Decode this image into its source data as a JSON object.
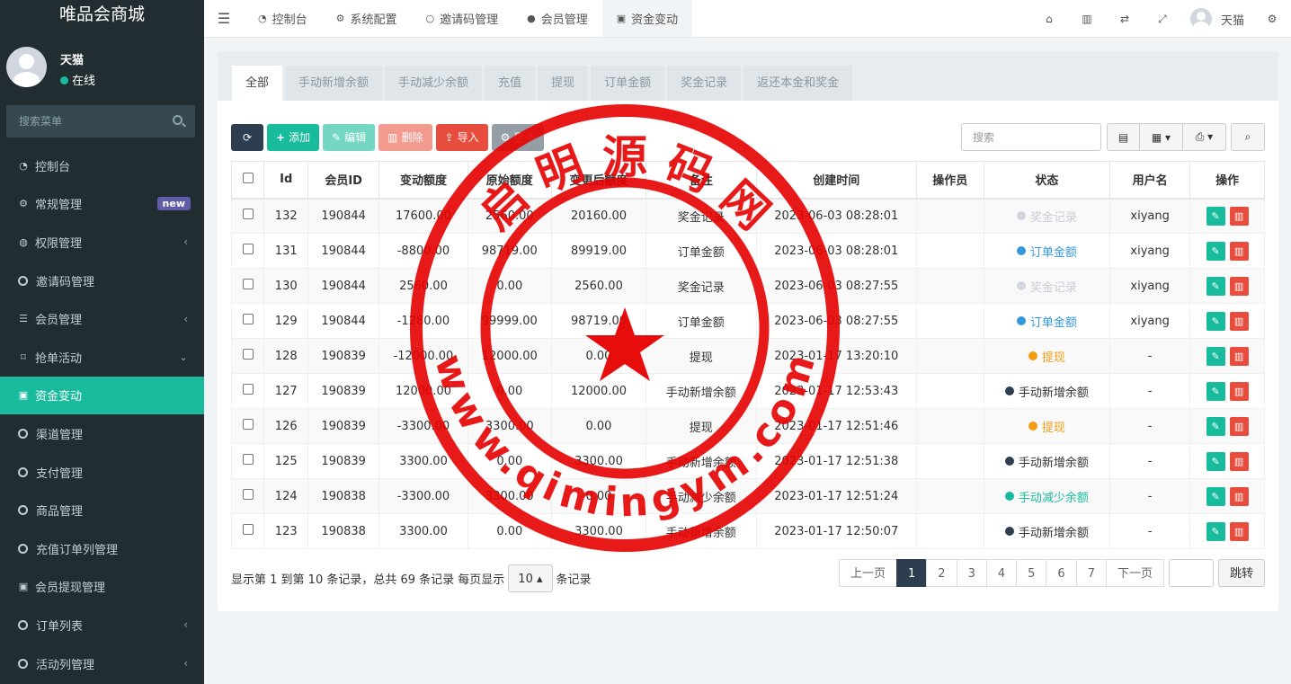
{
  "app": {
    "title": "唯品会商城"
  },
  "user": {
    "name": "天猫",
    "status": "在线"
  },
  "sidebar": {
    "search_placeholder": "搜索菜单",
    "items": [
      {
        "label": "控制台",
        "icon": "dashboard-icon",
        "glyph": "◔"
      },
      {
        "label": "常规管理",
        "icon": "gears-icon",
        "glyph": "⚙",
        "badge": "new"
      },
      {
        "label": "权限管理",
        "icon": "group-icon",
        "glyph": "◍",
        "caret": "‹"
      },
      {
        "label": "邀请码管理",
        "icon": "circle-icon",
        "glyph": ""
      },
      {
        "label": "会员管理",
        "icon": "list-icon",
        "glyph": "☰",
        "caret": "‹"
      },
      {
        "label": "抢单活动",
        "icon": "bookmark-icon",
        "glyph": "⌑",
        "caret": "⌄"
      },
      {
        "label": "资金变动",
        "icon": "money-icon",
        "glyph": "▣",
        "active": true
      },
      {
        "label": "渠道管理",
        "icon": "circle-icon",
        "glyph": ""
      },
      {
        "label": "支付管理",
        "icon": "circle-icon",
        "glyph": ""
      },
      {
        "label": "商品管理",
        "icon": "circle-icon",
        "glyph": ""
      },
      {
        "label": "充值订单列管理",
        "icon": "circle-icon",
        "glyph": ""
      },
      {
        "label": "会员提现管理",
        "icon": "money-icon",
        "glyph": "▣"
      },
      {
        "label": "订单列表",
        "icon": "circle-icon",
        "glyph": "",
        "caret": "‹"
      },
      {
        "label": "活动列管理",
        "icon": "circle-icon",
        "glyph": "",
        "caret": "‹"
      }
    ]
  },
  "topnav": {
    "tabs": [
      {
        "label": "控制台",
        "icon": "dashboard-icon",
        "glyph": "◔"
      },
      {
        "label": "系统配置",
        "icon": "gear-icon",
        "glyph": "⚙"
      },
      {
        "label": "邀请码管理",
        "icon": "circle-icon",
        "glyph": "○"
      },
      {
        "label": "会员管理",
        "icon": "user-icon",
        "glyph": "●"
      },
      {
        "label": "资金变动",
        "icon": "money-icon",
        "glyph": "▣",
        "active": true
      }
    ],
    "right_icons": [
      {
        "name": "home-icon",
        "glyph": "⌂"
      },
      {
        "name": "trash-icon",
        "glyph": "▥"
      },
      {
        "name": "translate-icon",
        "glyph": "⇄"
      },
      {
        "name": "fullscreen-icon",
        "glyph": "⤢"
      }
    ],
    "username": "天猫",
    "settings_glyph": "⚙"
  },
  "content": {
    "filter_tabs": [
      "全部",
      "手动新增余额",
      "手动减少余额",
      "充值",
      "提现",
      "订单金额",
      "奖金记录",
      "返还本金和奖金"
    ],
    "active_filter": 0,
    "toolbar": {
      "refresh": "⟳",
      "add": "添加",
      "edit": "编辑",
      "delete": "删除",
      "import": "导入",
      "more": "更多"
    },
    "search_placeholder": "搜索",
    "columns": [
      "",
      "Id",
      "会员ID",
      "变动额度",
      "原始额度",
      "变更后额度",
      "备注",
      "创建时间",
      "操作员",
      "状态",
      "用户名",
      "操作"
    ],
    "rows": [
      {
        "id": "132",
        "member": "190844",
        "change": "17600.00",
        "orig": "2560.00",
        "after": "20160.00",
        "note": "奖金记录",
        "time": "2023-06-03 08:28:01",
        "op": "",
        "status": "奖金记录",
        "scolor": "#d2d6de",
        "tcolor": "#c8cdd2",
        "user": "xiyang"
      },
      {
        "id": "131",
        "member": "190844",
        "change": "-8800.00",
        "orig": "98719.00",
        "after": "89919.00",
        "note": "订单金额",
        "time": "2023-06-03 08:28:01",
        "op": "",
        "status": "订单金额",
        "scolor": "#3498db",
        "tcolor": "#3498db",
        "user": "xiyang"
      },
      {
        "id": "130",
        "member": "190844",
        "change": "2560.00",
        "orig": "0.00",
        "after": "2560.00",
        "note": "奖金记录",
        "time": "2023-06-03 08:27:55",
        "op": "",
        "status": "奖金记录",
        "scolor": "#d2d6de",
        "tcolor": "#c8cdd2",
        "user": "xiyang"
      },
      {
        "id": "129",
        "member": "190844",
        "change": "-1280.00",
        "orig": "99999.00",
        "after": "98719.00",
        "note": "订单金额",
        "time": "2023-06-03 08:27:55",
        "op": "",
        "status": "订单金额",
        "scolor": "#3498db",
        "tcolor": "#3498db",
        "user": "xiyang"
      },
      {
        "id": "128",
        "member": "190839",
        "change": "-12000.00",
        "orig": "12000.00",
        "after": "0.00",
        "note": "提现",
        "time": "2023-01-17 13:20:10",
        "op": "",
        "status": "提现",
        "scolor": "#f39c12",
        "tcolor": "#f39c12",
        "user": "-"
      },
      {
        "id": "127",
        "member": "190839",
        "change": "12000.00",
        "orig": "0.00",
        "after": "12000.00",
        "note": "手动新增余额",
        "time": "2023-01-17 12:53:43",
        "op": "",
        "status": "手动新增余额",
        "scolor": "#2c3e50",
        "tcolor": "#333333",
        "user": "-"
      },
      {
        "id": "126",
        "member": "190839",
        "change": "-3300.00",
        "orig": "3300.00",
        "after": "0.00",
        "note": "提现",
        "time": "2023-01-17 12:51:46",
        "op": "",
        "status": "提现",
        "scolor": "#f39c12",
        "tcolor": "#f39c12",
        "user": "-"
      },
      {
        "id": "125",
        "member": "190839",
        "change": "3300.00",
        "orig": "0.00",
        "after": "3300.00",
        "note": "手动新增余额",
        "time": "2023-01-17 12:51:38",
        "op": "",
        "status": "手动新增余额",
        "scolor": "#2c3e50",
        "tcolor": "#333333",
        "user": "-"
      },
      {
        "id": "124",
        "member": "190838",
        "change": "-3300.00",
        "orig": "3300.00",
        "after": "0.00",
        "note": "手动减少余额",
        "time": "2023-01-17 12:51:24",
        "op": "",
        "status": "手动减少余额",
        "scolor": "#18bc9c",
        "tcolor": "#18bc9c",
        "user": "-"
      },
      {
        "id": "123",
        "member": "190838",
        "change": "3300.00",
        "orig": "0.00",
        "after": "3300.00",
        "note": "手动新增余额",
        "time": "2023-01-17 12:50:07",
        "op": "",
        "status": "手动新增余额",
        "scolor": "#2c3e50",
        "tcolor": "#333333",
        "user": "-"
      }
    ],
    "pagination": {
      "info_prefix": "显示第 1 到第 10 条记录，总共 69 条记录 每页显示",
      "page_size": "10",
      "info_suffix": "条记录",
      "prev": "上一页",
      "pages": [
        "1",
        "2",
        "3",
        "4",
        "5",
        "6",
        "7"
      ],
      "current": "1",
      "next": "下一页",
      "go": "跳转"
    }
  },
  "watermark": {
    "top_text": "启 明 源 码 网",
    "bottom_text": "www.qimingym.com",
    "color": "#e60000"
  }
}
